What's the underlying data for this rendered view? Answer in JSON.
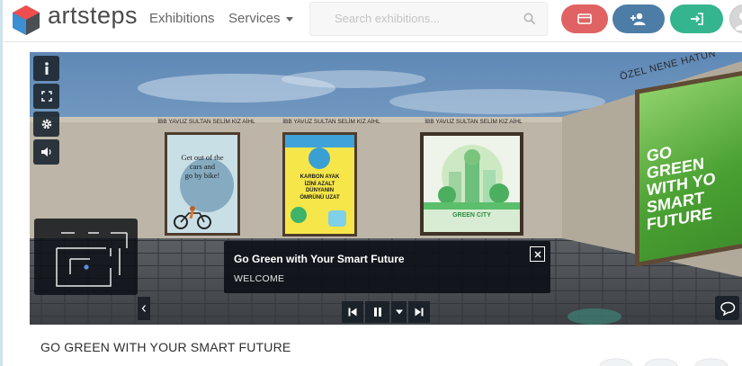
{
  "header": {
    "logo_text": "artsteps",
    "nav": {
      "exhibitions": "Exhibitions",
      "services": "Services"
    },
    "search": {
      "placeholder": "Search exhibitions..."
    },
    "buttons": [
      {
        "icon": "card-icon",
        "color": "#e06262"
      },
      {
        "icon": "add-user-icon",
        "color": "#4d7da6"
      },
      {
        "icon": "login-icon",
        "color": "#35b58f"
      }
    ]
  },
  "viewer": {
    "controls": [
      "info-icon",
      "fullscreen-icon",
      "gear-icon",
      "volume-icon"
    ],
    "artworks": [
      {
        "label": "İBB YAVUZ SULTAN SELİM KIZ AİHL",
        "poster_text": [
          "Get out of the",
          "cars and",
          "go by bike!"
        ]
      },
      {
        "label": "İBB YAVUZ SULTAN SELİM KIZ AİHL",
        "poster_text": [
          "KARBON AYAK",
          "İZİNİ AZALT",
          "DÜNYANIN",
          "ÖMRÜNÜ UZAT"
        ]
      },
      {
        "label": "İBB YAVUZ SULTAN SELİM KIZ AİHL",
        "poster_text": [
          "GREEN CITY"
        ]
      }
    ],
    "side_wall_label": "ÖZEL NENE HATUN",
    "big_poster_text": [
      "GO",
      "GREEN",
      "WITH YO",
      "SMART",
      "FUTURE"
    ],
    "caption": {
      "title": "Go Green with Your Smart Future",
      "subtitle": "WELCOME"
    },
    "playback": [
      "previous-icon",
      "pause-icon",
      "caret-down-icon",
      "next-icon"
    ]
  },
  "exhibition_title": "GO GREEN WITH YOUR SMART FUTURE"
}
